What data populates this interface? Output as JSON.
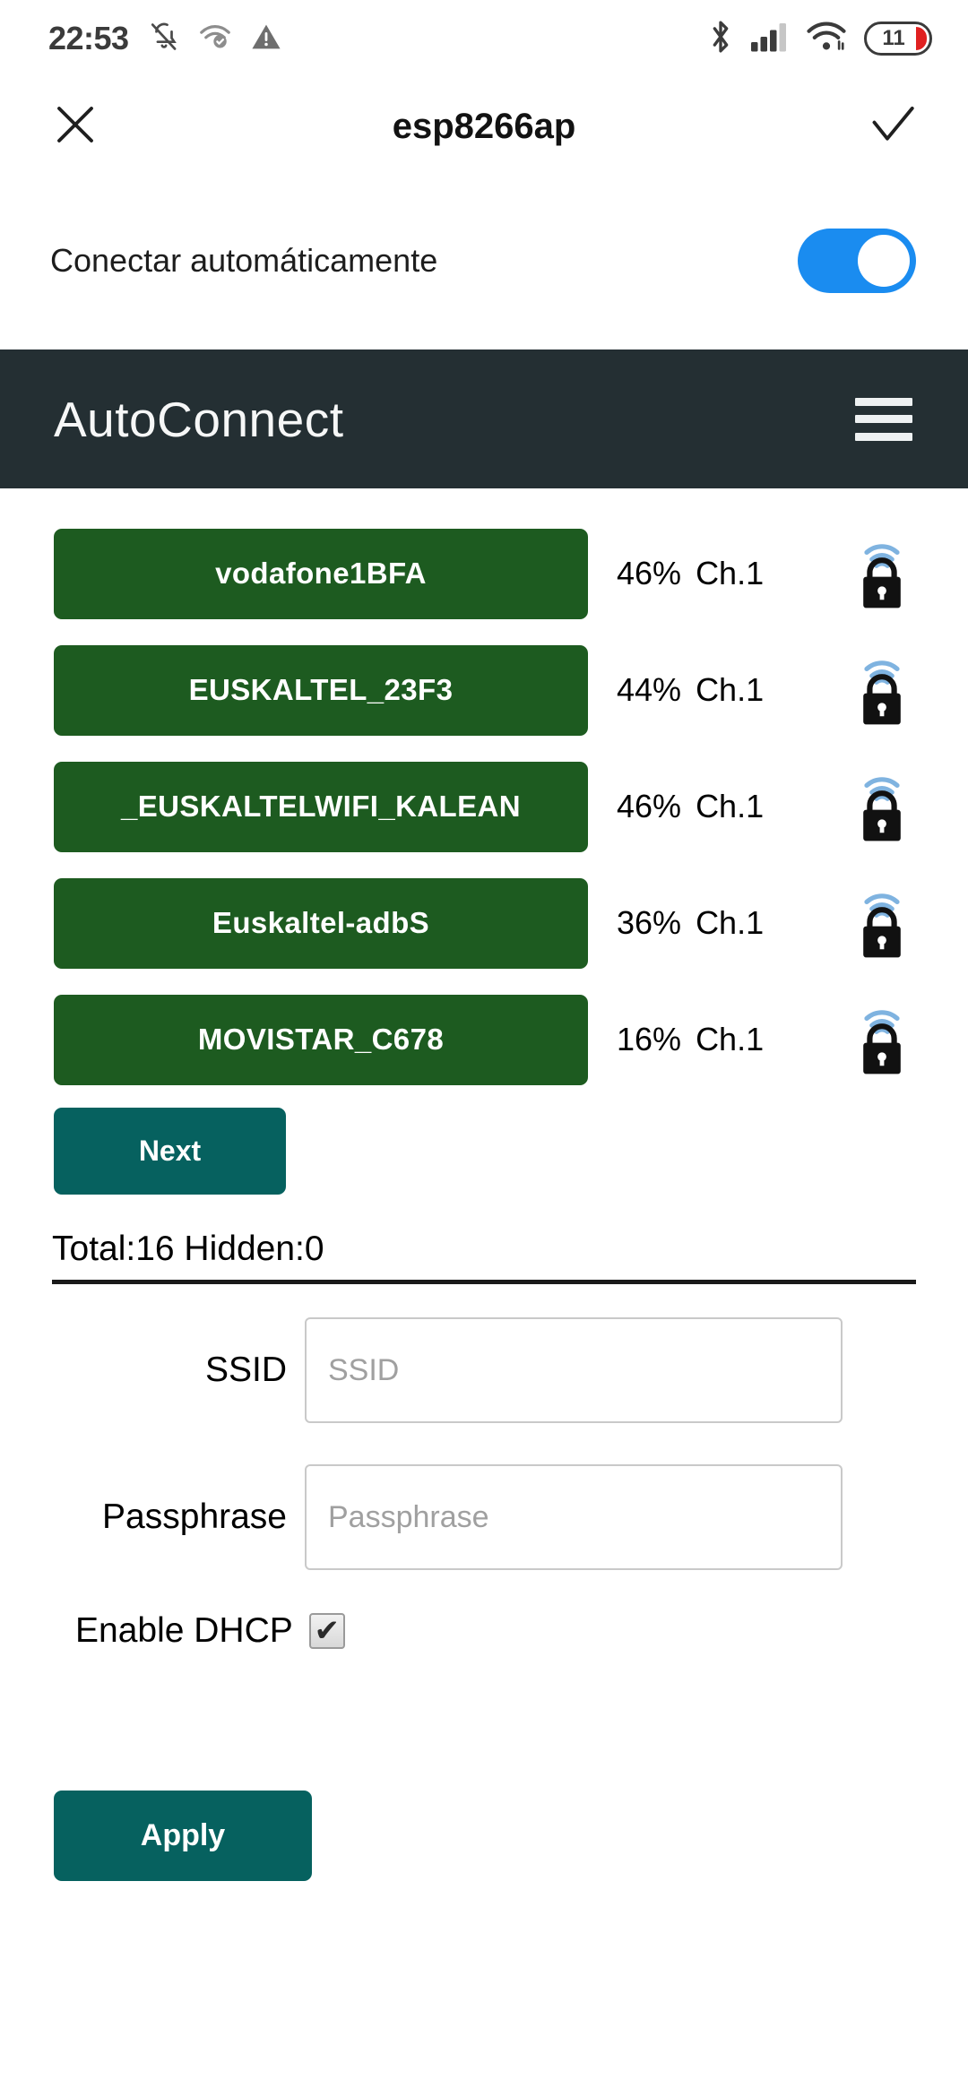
{
  "status_bar": {
    "time": "22:53",
    "left_icons": [
      "notifications-off-icon",
      "wifi-verified-icon",
      "warning-triangle-icon"
    ],
    "right_icons": [
      "bluetooth-icon",
      "cellular-signal-icon",
      "wifi-icon"
    ],
    "battery_percent": "11"
  },
  "title_bar": {
    "close_icon": "close-icon",
    "title": "esp8266ap",
    "confirm_icon": "check-icon"
  },
  "auto_connect": {
    "label": "Conectar automáticamente",
    "enabled": true,
    "accent_color": "#1a8cf0"
  },
  "brand_bar": {
    "title": "AutoConnect",
    "menu_icon": "hamburger-menu-icon",
    "background_color": "#242f33"
  },
  "networks": {
    "accent_color": "#1d5b20",
    "items": [
      {
        "ssid": "vodafone1BFA",
        "signal": "46%",
        "channel": "Ch.1",
        "secured": true
      },
      {
        "ssid": "EUSKALTEL_23F3",
        "signal": "44%",
        "channel": "Ch.1",
        "secured": true
      },
      {
        "ssid": "_EUSKALTELWIFI_KALEAN",
        "signal": "46%",
        "channel": "Ch.1",
        "secured": true
      },
      {
        "ssid": "Euskaltel-adbS",
        "signal": "36%",
        "channel": "Ch.1",
        "secured": true
      },
      {
        "ssid": "MOVISTAR_C678",
        "signal": "16%",
        "channel": "Ch.1",
        "secured": true
      }
    ]
  },
  "next_button": {
    "label": "Next",
    "color": "#06615f"
  },
  "totals": {
    "text": "Total:16 Hidden:0"
  },
  "form": {
    "ssid": {
      "label": "SSID",
      "value": "",
      "placeholder": "SSID"
    },
    "passphrase": {
      "label": "Passphrase",
      "value": "",
      "placeholder": "Passphrase"
    },
    "dhcp": {
      "label": "Enable DHCP",
      "checked": true,
      "check_glyph": "✔"
    }
  },
  "apply_button": {
    "label": "Apply",
    "color": "#06615f"
  }
}
